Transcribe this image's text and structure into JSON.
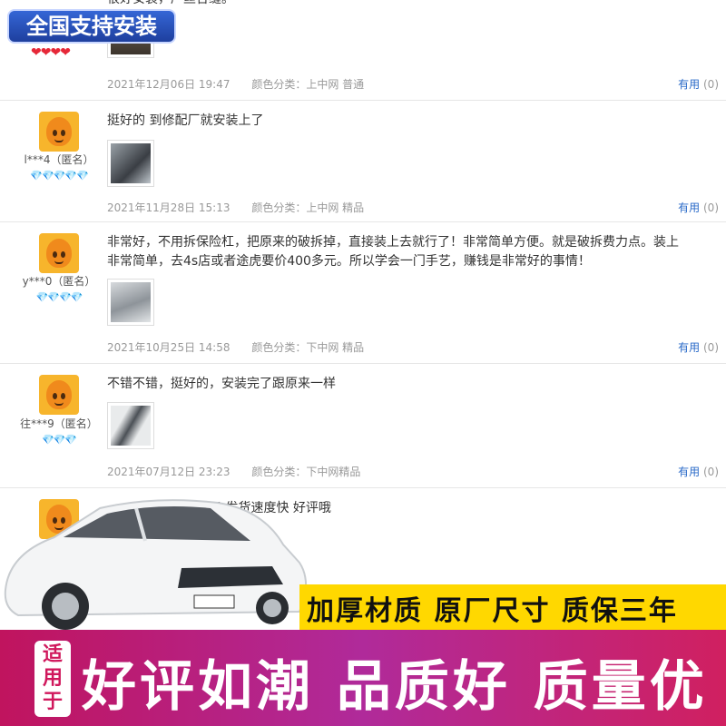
{
  "badge": {
    "text": "全国支持安装"
  },
  "top_review": {
    "text": "很好安装，严丝合缝。",
    "hearts": "❤❤❤❤",
    "date": "2021年12月06日 19:47",
    "color": "颜色分类：上中网 普通",
    "useful_label": "有用",
    "useful_count": "(0)"
  },
  "reviews": [
    {
      "user": "l***4（匿名）",
      "gems": "💎💎💎💎💎",
      "text": "挺好的 到修配厂就安装上了",
      "date": "2021年11月28日 15:13",
      "color": "颜色分类：上中网 精品",
      "useful_label": "有用",
      "useful_count": "(0)"
    },
    {
      "user": "y***0（匿名）",
      "gems": "💎💎💎💎",
      "text": "非常好，不用拆保险杠，把原来的破拆掉，直接装上去就行了！非常简单方便。就是破拆费力点。装上",
      "text2": "非常简单，去4s店或者途虎要价400多元。所以学会一门手艺，赚钱是非常好的事情！",
      "date": "2021年10月25日 14:58",
      "color": "颜色分类：下中网 精品",
      "useful_label": "有用",
      "useful_count": "(0)"
    },
    {
      "user": "往***9（匿名）",
      "gems": "💎💎💎",
      "text": "不错不错，挺好的，安装完了跟原来一样",
      "date": "2021年07月12日 23:23",
      "color": "颜色分类：下中网精品",
      "useful_label": "有用",
      "useful_count": "(0)"
    },
    {
      "text": "了 发货速度快 好评哦"
    }
  ],
  "promo": {
    "strip": "加厚材质 原厂尺寸 质保三年",
    "shi_1": "适",
    "shi_2": "用",
    "shi_3": "于",
    "big": "好评如潮 品质好 质量优"
  },
  "colors": {
    "accent_blue": "#2a6ac8",
    "promo_yellow": "#ffd800",
    "promo_magenta": "#c0145e"
  }
}
